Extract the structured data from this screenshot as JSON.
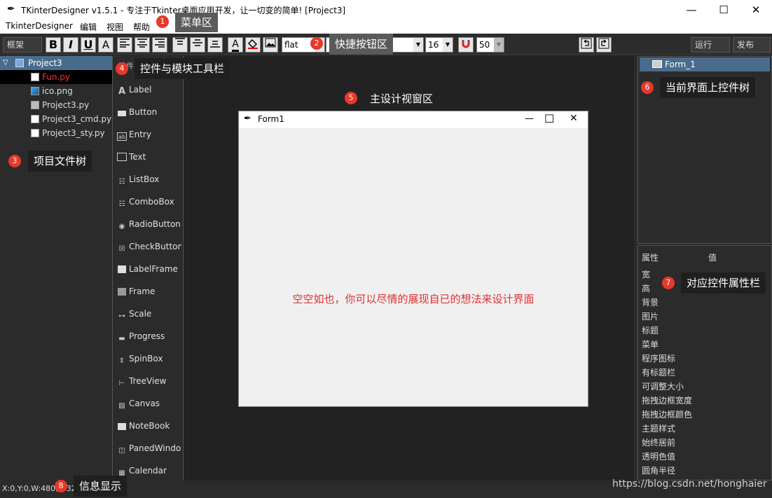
{
  "window": {
    "title": "TKinterDesigner v1.5.1 - 专注于Tkinter桌面应用开发，让一切变的简单!    [Project3]",
    "minimize": "—",
    "maximize": "☐",
    "close": "✕"
  },
  "menu": [
    "TkinterDesigner",
    "编辑",
    "视图",
    "帮助"
  ],
  "toolbar": {
    "frame_select": "框架",
    "bold": "B",
    "italic": "I",
    "underline": "U",
    "font_a": "A",
    "relief": "flat",
    "relief_arrow": "▼",
    "font_family_arrow": "▼",
    "font_size": "16",
    "font_size_arrow": "▼",
    "alpha": "50",
    "alpha_arrow": "▼",
    "run": "运行",
    "publish": "发布"
  },
  "project_tree": {
    "root": "Project3",
    "files": [
      {
        "name": "Fun.py",
        "color": "#ff2a2a"
      },
      {
        "name": "ico.png",
        "color": "#e0e0e0"
      },
      {
        "name": "Project3.py",
        "color": "#e0e0e0"
      },
      {
        "name": "Project3_cmd.py",
        "color": "#e0e0e0"
      },
      {
        "name": "Project3_sty.py",
        "color": "#e0e0e0"
      }
    ]
  },
  "widgets": {
    "header": "控件",
    "items": [
      "Label",
      "Button",
      "Entry",
      "Text",
      "ListBox",
      "ComboBox",
      "RadioButton",
      "CheckButton",
      "LabelFrame",
      "Frame",
      "Scale",
      "Progress",
      "SpinBox",
      "TreeView",
      "Canvas",
      "NoteBook",
      "PanedWindow",
      "Calendar"
    ]
  },
  "form": {
    "title": "Form1",
    "min": "—",
    "max": "☐",
    "close": "✕",
    "message": "空空如也，你可以尽情的展现自已的想法来设计界面"
  },
  "control_tree": {
    "root": "Form_1"
  },
  "properties": {
    "col_attr": "属性",
    "col_value": "值",
    "items": [
      "宽",
      "高",
      "背景",
      "图片",
      "标题",
      "菜单",
      "程序图标",
      "有标题栏",
      "可调整大小",
      "拖拽边框宽度",
      "拖拽边框颜色",
      "主题样式",
      "始终居前",
      "透明色值",
      "圆角半径"
    ]
  },
  "status": {
    "text": "X:0,Y:0,W:480,H:320"
  },
  "annotations": [
    {
      "num": "1",
      "text": "菜单区"
    },
    {
      "num": "2",
      "text": "快捷按钮区"
    },
    {
      "num": "3",
      "text": "项目文件树"
    },
    {
      "num": "4",
      "text": "控件与模块工具栏"
    },
    {
      "num": "5",
      "text": "主设计视窗区"
    },
    {
      "num": "6",
      "text": "当前界面上控件树"
    },
    {
      "num": "7",
      "text": "对应控件属性栏"
    },
    {
      "num": "8",
      "text": "信息显示"
    }
  ],
  "watermark": "https://blog.csdn.net/honghaier",
  "colors": {
    "accent_red": "#e8382b",
    "form_message": "#e03030",
    "selection_blue": "#4a6c8c"
  }
}
